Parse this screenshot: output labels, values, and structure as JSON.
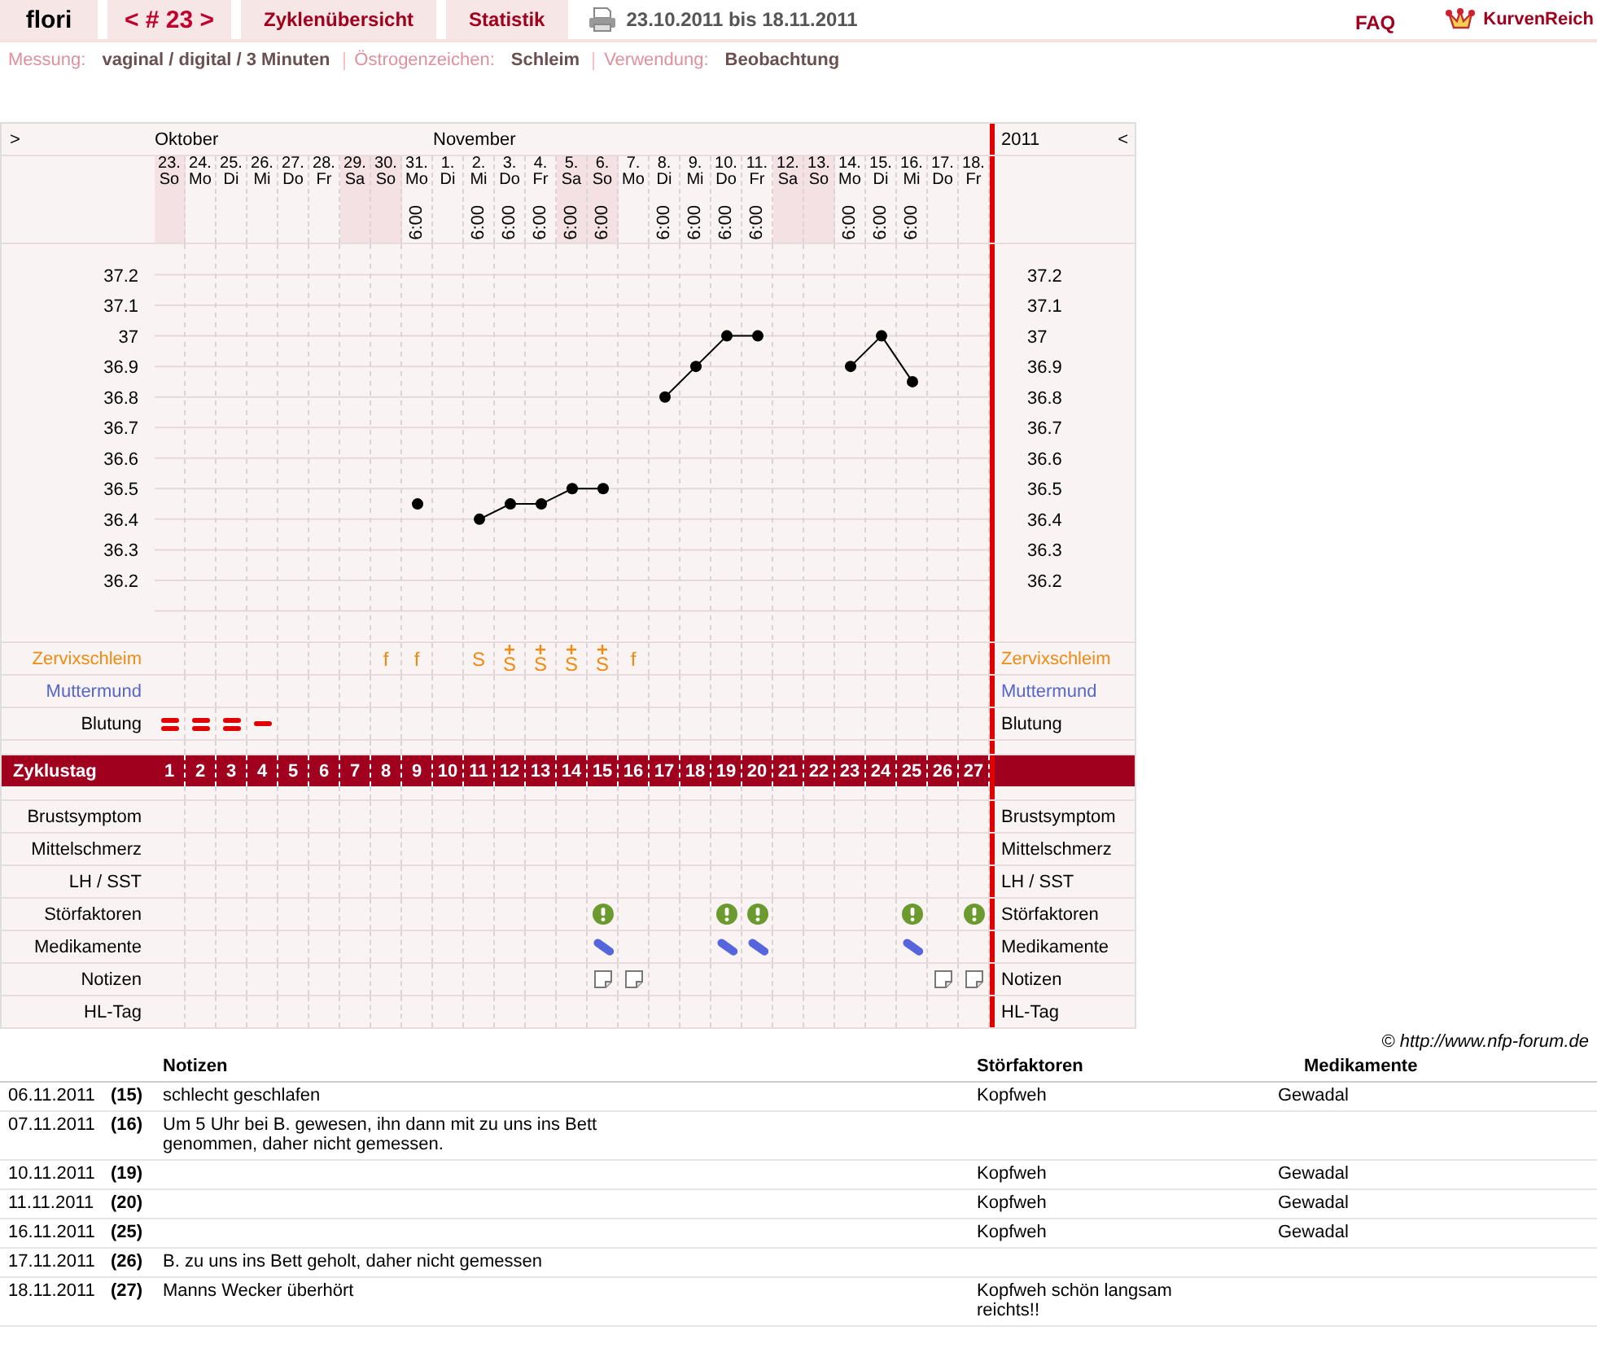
{
  "nav": {
    "user": "flori",
    "cycle": "< # 23 >",
    "tabs": [
      {
        "label": "Zyklenübersicht"
      },
      {
        "label": "Statistik"
      }
    ],
    "date_range": "23.10.2011 bis 18.11.2011",
    "faq": "FAQ",
    "logo": "KurvenReich"
  },
  "settings": [
    {
      "label": "Messung:",
      "value": "vaginal / digital / 3 Minuten"
    },
    {
      "label": "Östrogenzeichen:",
      "value": "Schleim"
    },
    {
      "label": "Verwendung:",
      "value": "Beobachtung"
    }
  ],
  "chart": {
    "prev": ">",
    "next": "<",
    "year": "2011",
    "days": [
      {
        "date": "23.",
        "weekday": "So",
        "weekend": true,
        "month": "Oktober",
        "bleeding": true,
        "bleeding_heavy": true
      },
      {
        "date": "24.",
        "weekday": "Mo",
        "weekend": false,
        "bleeding": true,
        "bleeding_heavy": true
      },
      {
        "date": "25.",
        "weekday": "Di",
        "weekend": false,
        "bleeding": true,
        "bleeding_heavy": true
      },
      {
        "date": "26.",
        "weekday": "Mi",
        "weekend": false,
        "bleeding": true,
        "bleeding_heavy": false
      },
      {
        "date": "27.",
        "weekday": "Do",
        "weekend": false
      },
      {
        "date": "28.",
        "weekday": "Fr",
        "weekend": false
      },
      {
        "date": "29.",
        "weekday": "Sa",
        "weekend": true
      },
      {
        "date": "30.",
        "weekday": "So",
        "weekend": true,
        "mucus": "f",
        "mucus_plus": false
      },
      {
        "date": "31.",
        "weekday": "Mo",
        "weekend": false,
        "time": "6:00",
        "mucus": "f",
        "mucus_plus": false
      },
      {
        "date": "1.",
        "weekday": "Di",
        "weekend": false,
        "month": "November"
      },
      {
        "date": "2.",
        "weekday": "Mi",
        "weekend": false,
        "time": "6:00",
        "mucus": "S",
        "mucus_plus": false
      },
      {
        "date": "3.",
        "weekday": "Do",
        "weekend": false,
        "time": "6:00",
        "mucus": "S",
        "mucus_plus": true
      },
      {
        "date": "4.",
        "weekday": "Fr",
        "weekend": false,
        "time": "6:00",
        "mucus": "S",
        "mucus_plus": true
      },
      {
        "date": "5.",
        "weekday": "Sa",
        "weekend": true,
        "time": "6:00",
        "mucus": "S",
        "mucus_plus": true
      },
      {
        "date": "6.",
        "weekday": "So",
        "weekend": true,
        "time": "6:00",
        "mucus": "S",
        "mucus_plus": true,
        "disturbance": true,
        "medication": true,
        "note": true
      },
      {
        "date": "7.",
        "weekday": "Mo",
        "weekend": false,
        "mucus": "f",
        "mucus_plus": false,
        "note": true
      },
      {
        "date": "8.",
        "weekday": "Di",
        "weekend": false,
        "time": "6:00"
      },
      {
        "date": "9.",
        "weekday": "Mi",
        "weekend": false,
        "time": "6:00"
      },
      {
        "date": "10.",
        "weekday": "Do",
        "weekend": false,
        "time": "6:00",
        "disturbance": true,
        "medication": true
      },
      {
        "date": "11.",
        "weekday": "Fr",
        "weekend": false,
        "time": "6:00",
        "disturbance": true,
        "medication": true
      },
      {
        "date": "12.",
        "weekday": "Sa",
        "weekend": true
      },
      {
        "date": "13.",
        "weekday": "So",
        "weekend": true
      },
      {
        "date": "14.",
        "weekday": "Mo",
        "weekend": false,
        "time": "6:00"
      },
      {
        "date": "15.",
        "weekday": "Di",
        "weekend": false,
        "time": "6:00"
      },
      {
        "date": "16.",
        "weekday": "Mi",
        "weekend": false,
        "time": "6:00",
        "disturbance": true,
        "medication": true
      },
      {
        "date": "17.",
        "weekday": "Do",
        "weekend": false,
        "note": true
      },
      {
        "date": "18.",
        "weekday": "Fr",
        "weekend": false,
        "disturbance": true,
        "note": true
      }
    ],
    "cycle_days": [
      "1",
      "2",
      "3",
      "4",
      "5",
      "6",
      "7",
      "8",
      "9",
      "10",
      "11",
      "12",
      "13",
      "14",
      "15",
      "16",
      "17",
      "18",
      "19",
      "20",
      "21",
      "22",
      "23",
      "24",
      "25",
      "26",
      "27"
    ],
    "right_axis_labels": [
      "37.2",
      "37.1",
      "37",
      "36.9",
      "36.8",
      "36.7",
      "36.6",
      "36.5",
      "36.4",
      "36.3",
      "36.2"
    ],
    "chart_data": {
      "type": "line",
      "grid": true,
      "ylim": [
        36.0,
        37.3
      ],
      "yticks": [
        {
          "value": 36.2,
          "label": "36.2"
        },
        {
          "value": 36.3,
          "label": "36.3"
        },
        {
          "value": 36.4,
          "label": "36.4"
        },
        {
          "value": 36.5,
          "label": "36.5"
        },
        {
          "value": 36.6,
          "label": "36.6"
        },
        {
          "value": 36.7,
          "label": "36.7"
        },
        {
          "value": 36.8,
          "label": "36.8"
        },
        {
          "value": 36.9,
          "label": "36.9"
        },
        {
          "value": 37.0,
          "label": "37"
        },
        {
          "value": 37.1,
          "label": "37.1"
        },
        {
          "value": 37.2,
          "label": "37.2"
        }
      ],
      "series": [
        {
          "color": "#000000",
          "marker": "circle",
          "values": [
            null,
            null,
            null,
            null,
            null,
            null,
            null,
            null,
            36.45,
            null,
            36.4,
            36.45,
            36.45,
            36.5,
            36.5,
            null,
            36.8,
            36.9,
            37.0,
            37.0,
            null,
            null,
            36.9,
            37.0,
            36.85,
            null,
            null
          ]
        }
      ]
    },
    "rows_top": [
      {
        "kind": "mucus",
        "label": "Zervixschleim",
        "right_label": "Zervixschleim",
        "color": "#f08a10"
      },
      {
        "kind": "cervix",
        "label": "Muttermund",
        "right_label": "Muttermund",
        "color": "#5566cc"
      },
      {
        "kind": "bleeding",
        "label": "Blutung",
        "right_label": "Blutung",
        "color": "#000000"
      }
    ],
    "cycle_label": "Zyklustag",
    "rows_bottom": [
      {
        "kind": "breast",
        "label": "Brustsymptom",
        "right_label": "Brustsymptom"
      },
      {
        "kind": "pain",
        "label": "Mittelschmerz",
        "right_label": "Mittelschmerz"
      },
      {
        "kind": "lh",
        "label": "LH / SST",
        "right_label": "LH / SST"
      },
      {
        "kind": "disturbance",
        "label": "Störfaktoren",
        "right_label": "Störfaktoren"
      },
      {
        "kind": "medication",
        "label": "Medikamente",
        "right_label": "Medikamente"
      },
      {
        "kind": "note",
        "label": "Notizen",
        "right_label": "Notizen"
      },
      {
        "kind": "hl",
        "label": "HL-Tag",
        "right_label": "HL-Tag"
      }
    ]
  },
  "copyright": "© http://www.nfp-forum.de",
  "notes": {
    "columns": [
      "Notizen",
      "Störfaktoren",
      "Medikamente"
    ],
    "rows": [
      {
        "date": "06.11.2011",
        "day": "(15)",
        "note": "schlecht geschlafen",
        "disturbance": "Kopfweh",
        "medication": "Gewadal"
      },
      {
        "date": "07.11.2011",
        "day": "(16)",
        "note": "Um 5 Uhr bei B. gewesen, ihn dann mit zu uns ins Bett genommen, daher nicht gemessen."
      },
      {
        "date": "10.11.2011",
        "day": "(19)",
        "disturbance": "Kopfweh",
        "medication": "Gewadal"
      },
      {
        "date": "11.11.2011",
        "day": "(20)",
        "disturbance": "Kopfweh",
        "medication": "Gewadal"
      },
      {
        "date": "16.11.2011",
        "day": "(25)",
        "disturbance": "Kopfweh",
        "medication": "Gewadal"
      },
      {
        "date": "17.11.2011",
        "day": "(26)",
        "note": "B. zu uns ins Bett geholt, daher nicht gemessen"
      },
      {
        "date": "18.11.2011",
        "day": "(27)",
        "note": "Manns Wecker überhört",
        "disturbance": "Kopfweh schön langsam reichts!!"
      }
    ]
  }
}
